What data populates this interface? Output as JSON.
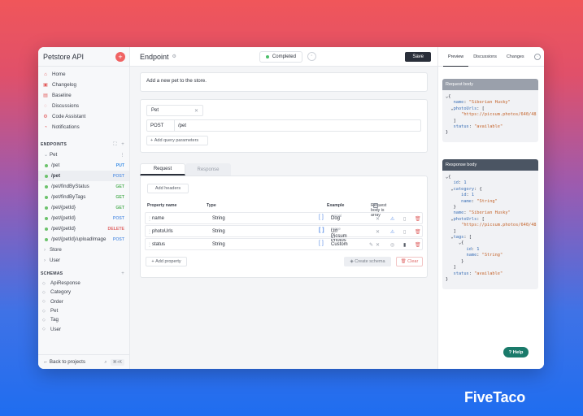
{
  "sidebar": {
    "title": "Petstore API",
    "nav": [
      {
        "label": "Home",
        "icon": "home-icon"
      },
      {
        "label": "Changelog",
        "icon": "changelog-icon"
      },
      {
        "label": "Baseline",
        "icon": "baseline-icon"
      },
      {
        "label": "Discussions",
        "icon": "discussions-icon"
      },
      {
        "label": "Code Assistant",
        "icon": "code-icon"
      },
      {
        "label": "Notifications",
        "icon": "bell-icon"
      }
    ],
    "endpoints_header": "ENDPOINTS",
    "pet_group": "Pet",
    "endpoints": [
      {
        "path": "/pet",
        "method": "PUT"
      },
      {
        "path": "/pet",
        "method": "POST"
      },
      {
        "path": "/pet/findByStatus",
        "method": "GET"
      },
      {
        "path": "/pet/findByTags",
        "method": "GET"
      },
      {
        "path": "/pet/{petId}",
        "method": "GET"
      },
      {
        "path": "/pet/{petId}",
        "method": "POST"
      },
      {
        "path": "/pet/{petId}",
        "method": "DELETE"
      },
      {
        "path": "/pet/{petId}/uploadImage",
        "method": "POST"
      }
    ],
    "other_groups": [
      "Store",
      "User"
    ],
    "schemas_header": "SCHEMAS",
    "schemas": [
      "ApiResponse",
      "Category",
      "Order",
      "Pet",
      "Tag",
      "User"
    ],
    "back_label": "Back to projects",
    "shortcut": "⌘+K"
  },
  "main": {
    "title": "Endpoint",
    "status": "Completed",
    "save_label": "Save",
    "description": "Add a new pet to the store.",
    "tag": "Pet",
    "method": "POST",
    "path": "/pet",
    "query_button": "Add query parameters",
    "tabs": [
      "Request",
      "Response"
    ],
    "add_headers": "Add headers",
    "columns": {
      "name": "Property name",
      "type": "Type",
      "example": "Example",
      "array": "Request body is array"
    },
    "rows": [
      {
        "name": "name",
        "type": "String",
        "bracket": "[ ]",
        "example_hint": "Animal",
        "example": "Dog"
      },
      {
        "name": "photoUrls",
        "type": "String",
        "bracket": "[ ]",
        "example_hint": "Image",
        "example": "Url Picsum Photos"
      },
      {
        "name": "status",
        "type": "String",
        "bracket": "[ ]",
        "example_hint": "",
        "example": "Custom"
      }
    ],
    "add_property": "Add property",
    "create_schema": "Create schema",
    "clear": "Clear"
  },
  "right": {
    "tabs": [
      "Preview",
      "Discussions",
      "Changes"
    ],
    "request_title": "Request body",
    "response_title": "Response body",
    "help": "Help"
  },
  "brand": "FiveTaco",
  "colors": {
    "accent": "#f06363",
    "status_green": "#4cbf6a",
    "help": "#1a7a6a"
  }
}
